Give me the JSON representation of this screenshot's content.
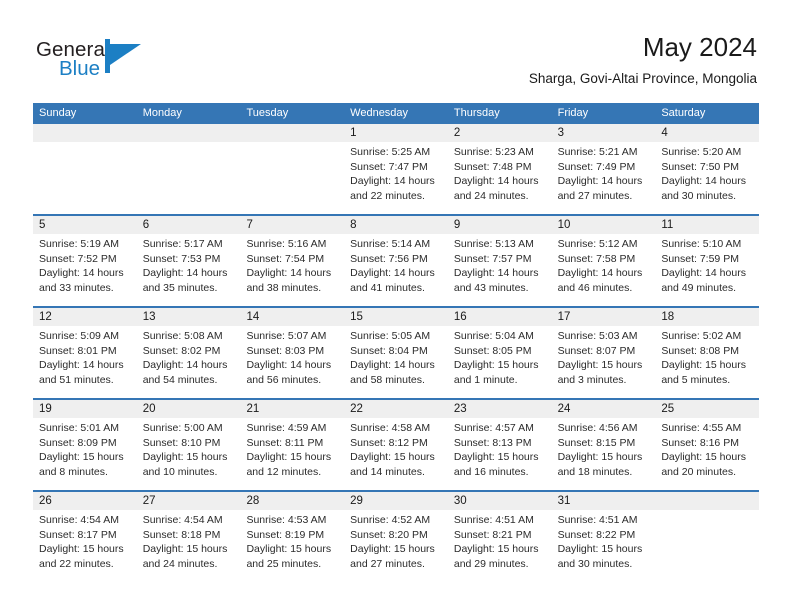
{
  "brand": {
    "name_part1": "General",
    "name_part2": "Blue",
    "logo_icon": "general-blue-logo"
  },
  "header": {
    "title": "May 2024",
    "subtitle": "Sharga, Govi-Altai Province, Mongolia"
  },
  "colors": {
    "header_blue": "#3576b5",
    "brand_blue": "#1c7fc4",
    "daynum_band": "#efefef",
    "text": "#1a1a1a"
  },
  "weekdays": [
    "Sunday",
    "Monday",
    "Tuesday",
    "Wednesday",
    "Thursday",
    "Friday",
    "Saturday"
  ],
  "weeks": [
    [
      {
        "day": "",
        "lines": []
      },
      {
        "day": "",
        "lines": []
      },
      {
        "day": "",
        "lines": []
      },
      {
        "day": "1",
        "lines": [
          "Sunrise: 5:25 AM",
          "Sunset: 7:47 PM",
          "Daylight: 14 hours",
          "and 22 minutes."
        ]
      },
      {
        "day": "2",
        "lines": [
          "Sunrise: 5:23 AM",
          "Sunset: 7:48 PM",
          "Daylight: 14 hours",
          "and 24 minutes."
        ]
      },
      {
        "day": "3",
        "lines": [
          "Sunrise: 5:21 AM",
          "Sunset: 7:49 PM",
          "Daylight: 14 hours",
          "and 27 minutes."
        ]
      },
      {
        "day": "4",
        "lines": [
          "Sunrise: 5:20 AM",
          "Sunset: 7:50 PM",
          "Daylight: 14 hours",
          "and 30 minutes."
        ]
      }
    ],
    [
      {
        "day": "5",
        "lines": [
          "Sunrise: 5:19 AM",
          "Sunset: 7:52 PM",
          "Daylight: 14 hours",
          "and 33 minutes."
        ]
      },
      {
        "day": "6",
        "lines": [
          "Sunrise: 5:17 AM",
          "Sunset: 7:53 PM",
          "Daylight: 14 hours",
          "and 35 minutes."
        ]
      },
      {
        "day": "7",
        "lines": [
          "Sunrise: 5:16 AM",
          "Sunset: 7:54 PM",
          "Daylight: 14 hours",
          "and 38 minutes."
        ]
      },
      {
        "day": "8",
        "lines": [
          "Sunrise: 5:14 AM",
          "Sunset: 7:56 PM",
          "Daylight: 14 hours",
          "and 41 minutes."
        ]
      },
      {
        "day": "9",
        "lines": [
          "Sunrise: 5:13 AM",
          "Sunset: 7:57 PM",
          "Daylight: 14 hours",
          "and 43 minutes."
        ]
      },
      {
        "day": "10",
        "lines": [
          "Sunrise: 5:12 AM",
          "Sunset: 7:58 PM",
          "Daylight: 14 hours",
          "and 46 minutes."
        ]
      },
      {
        "day": "11",
        "lines": [
          "Sunrise: 5:10 AM",
          "Sunset: 7:59 PM",
          "Daylight: 14 hours",
          "and 49 minutes."
        ]
      }
    ],
    [
      {
        "day": "12",
        "lines": [
          "Sunrise: 5:09 AM",
          "Sunset: 8:01 PM",
          "Daylight: 14 hours",
          "and 51 minutes."
        ]
      },
      {
        "day": "13",
        "lines": [
          "Sunrise: 5:08 AM",
          "Sunset: 8:02 PM",
          "Daylight: 14 hours",
          "and 54 minutes."
        ]
      },
      {
        "day": "14",
        "lines": [
          "Sunrise: 5:07 AM",
          "Sunset: 8:03 PM",
          "Daylight: 14 hours",
          "and 56 minutes."
        ]
      },
      {
        "day": "15",
        "lines": [
          "Sunrise: 5:05 AM",
          "Sunset: 8:04 PM",
          "Daylight: 14 hours",
          "and 58 minutes."
        ]
      },
      {
        "day": "16",
        "lines": [
          "Sunrise: 5:04 AM",
          "Sunset: 8:05 PM",
          "Daylight: 15 hours",
          "and 1 minute."
        ]
      },
      {
        "day": "17",
        "lines": [
          "Sunrise: 5:03 AM",
          "Sunset: 8:07 PM",
          "Daylight: 15 hours",
          "and 3 minutes."
        ]
      },
      {
        "day": "18",
        "lines": [
          "Sunrise: 5:02 AM",
          "Sunset: 8:08 PM",
          "Daylight: 15 hours",
          "and 5 minutes."
        ]
      }
    ],
    [
      {
        "day": "19",
        "lines": [
          "Sunrise: 5:01 AM",
          "Sunset: 8:09 PM",
          "Daylight: 15 hours",
          "and 8 minutes."
        ]
      },
      {
        "day": "20",
        "lines": [
          "Sunrise: 5:00 AM",
          "Sunset: 8:10 PM",
          "Daylight: 15 hours",
          "and 10 minutes."
        ]
      },
      {
        "day": "21",
        "lines": [
          "Sunrise: 4:59 AM",
          "Sunset: 8:11 PM",
          "Daylight: 15 hours",
          "and 12 minutes."
        ]
      },
      {
        "day": "22",
        "lines": [
          "Sunrise: 4:58 AM",
          "Sunset: 8:12 PM",
          "Daylight: 15 hours",
          "and 14 minutes."
        ]
      },
      {
        "day": "23",
        "lines": [
          "Sunrise: 4:57 AM",
          "Sunset: 8:13 PM",
          "Daylight: 15 hours",
          "and 16 minutes."
        ]
      },
      {
        "day": "24",
        "lines": [
          "Sunrise: 4:56 AM",
          "Sunset: 8:15 PM",
          "Daylight: 15 hours",
          "and 18 minutes."
        ]
      },
      {
        "day": "25",
        "lines": [
          "Sunrise: 4:55 AM",
          "Sunset: 8:16 PM",
          "Daylight: 15 hours",
          "and 20 minutes."
        ]
      }
    ],
    [
      {
        "day": "26",
        "lines": [
          "Sunrise: 4:54 AM",
          "Sunset: 8:17 PM",
          "Daylight: 15 hours",
          "and 22 minutes."
        ]
      },
      {
        "day": "27",
        "lines": [
          "Sunrise: 4:54 AM",
          "Sunset: 8:18 PM",
          "Daylight: 15 hours",
          "and 24 minutes."
        ]
      },
      {
        "day": "28",
        "lines": [
          "Sunrise: 4:53 AM",
          "Sunset: 8:19 PM",
          "Daylight: 15 hours",
          "and 25 minutes."
        ]
      },
      {
        "day": "29",
        "lines": [
          "Sunrise: 4:52 AM",
          "Sunset: 8:20 PM",
          "Daylight: 15 hours",
          "and 27 minutes."
        ]
      },
      {
        "day": "30",
        "lines": [
          "Sunrise: 4:51 AM",
          "Sunset: 8:21 PM",
          "Daylight: 15 hours",
          "and 29 minutes."
        ]
      },
      {
        "day": "31",
        "lines": [
          "Sunrise: 4:51 AM",
          "Sunset: 8:22 PM",
          "Daylight: 15 hours",
          "and 30 minutes."
        ]
      },
      {
        "day": "",
        "lines": []
      }
    ]
  ]
}
